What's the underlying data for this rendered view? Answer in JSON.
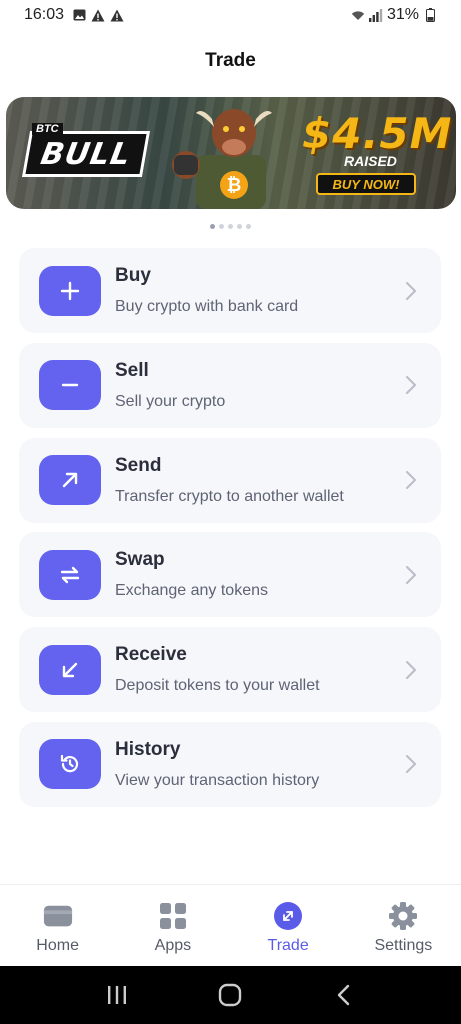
{
  "status_bar": {
    "time": "16:03",
    "battery": "31%",
    "left_icons": [
      "image-icon",
      "warning-icon",
      "warning-icon"
    ],
    "right_icons": [
      "wifi-icon",
      "signal-icon",
      "battery-icon"
    ]
  },
  "header": {
    "title": "Trade"
  },
  "banner": {
    "logo_small": "BTC",
    "logo": "BULL",
    "amount": "$4.5M",
    "raised": "RAISED",
    "cta": "BUY NOW!"
  },
  "carousel": {
    "count": 5,
    "active_index": 0
  },
  "actions": [
    {
      "title": "Buy",
      "subtitle": "Buy crypto with bank card",
      "icon": "plus-icon"
    },
    {
      "title": "Sell",
      "subtitle": "Sell your crypto",
      "icon": "minus-icon"
    },
    {
      "title": "Send",
      "subtitle": "Transfer crypto to another wallet",
      "icon": "arrow-up-right-icon"
    },
    {
      "title": "Swap",
      "subtitle": "Exchange any tokens",
      "icon": "swap-icon"
    },
    {
      "title": "Receive",
      "subtitle": "Deposit tokens to your wallet",
      "icon": "arrow-down-left-icon"
    },
    {
      "title": "History",
      "subtitle": "View your transaction history",
      "icon": "history-icon"
    }
  ],
  "bottom_nav": [
    {
      "label": "Home",
      "icon": "wallet-card-icon",
      "active": false
    },
    {
      "label": "Apps",
      "icon": "apps-grid-icon",
      "active": false
    },
    {
      "label": "Trade",
      "icon": "trade-icon",
      "active": true
    },
    {
      "label": "Settings",
      "icon": "gear-icon",
      "active": false
    }
  ],
  "colors": {
    "accent": "#6363f0",
    "card_bg": "#f6f7fb",
    "banner_gold": "#f4b716"
  }
}
